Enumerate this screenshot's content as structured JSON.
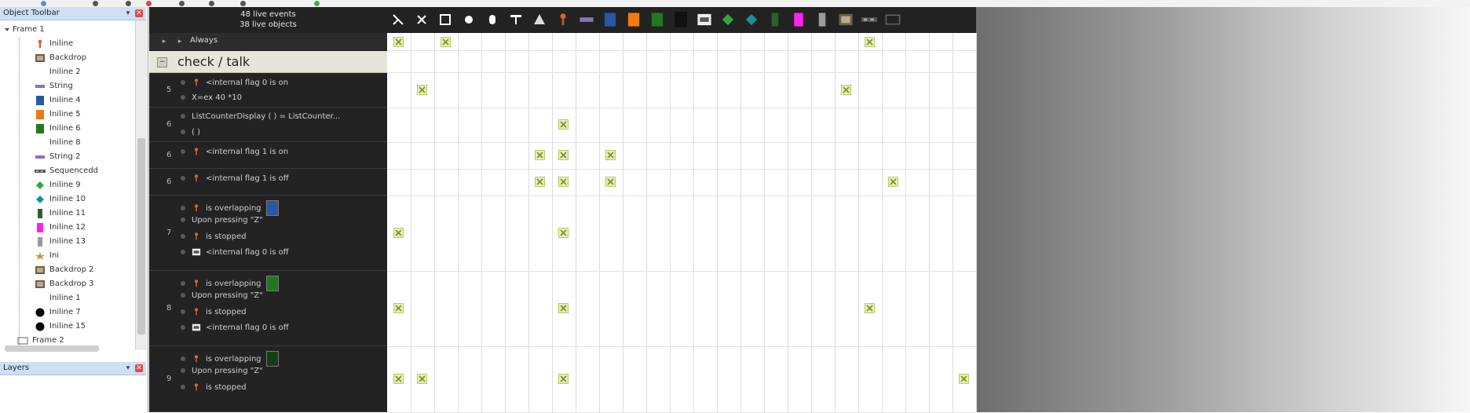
{
  "header": {
    "events_count": "48 live events",
    "objects_count": "38 live objects"
  },
  "left_panel": {
    "title": "Object Toolbar",
    "pin_glyph": "▾",
    "close_glyph": "✕",
    "tree_root": "Frame 1",
    "items": [
      {
        "label": "Iniline",
        "icon": "active-icon"
      },
      {
        "label": "Backdrop",
        "icon": "backdrop-icon"
      },
      {
        "label": "Iniline 2",
        "icon": "blank-icon"
      },
      {
        "label": "String",
        "icon": "string-icon"
      },
      {
        "label": "Iniline 4",
        "icon": "blue-square-icon"
      },
      {
        "label": "Iniline 5",
        "icon": "orange-square-icon"
      },
      {
        "label": "Iniline 6",
        "icon": "green-square-icon"
      },
      {
        "label": "Iniline 8",
        "icon": "blank-icon"
      },
      {
        "label": "String 2",
        "icon": "string-icon"
      },
      {
        "label": "Sequencedd",
        "icon": "sequence-icon"
      },
      {
        "label": "Iniline 9",
        "icon": "green-diamond-icon"
      },
      {
        "label": "Iniline 10",
        "icon": "teal-diamond-icon"
      },
      {
        "label": "Iniline 11",
        "icon": "dark-green-icon"
      },
      {
        "label": "Iniline 12",
        "icon": "magenta-icon"
      },
      {
        "label": "Iniline 13",
        "icon": "gray-bar-icon"
      },
      {
        "label": "Ini",
        "icon": "star-icon"
      },
      {
        "label": "Backdrop 2",
        "icon": "backdrop-icon"
      },
      {
        "label": "Backdrop 3",
        "icon": "backdrop-icon"
      },
      {
        "label": "Iniline 1",
        "icon": "blank-icon"
      },
      {
        "label": "Iniline 7",
        "icon": "black-circle-icon"
      },
      {
        "label": "Iniline 15",
        "icon": "black-circle-icon"
      },
      {
        "label": "Frame 2",
        "icon": "frame-icon"
      }
    ],
    "second_title": "Layers",
    "colors": {
      "blue": "#2a56a8",
      "orange": "#f07a12",
      "green": "#1f7a1f",
      "magenta": "#ff22ee"
    }
  },
  "toolbar": {
    "icons": [
      "system-icon",
      "special-icon",
      "storyboard-icon",
      "sound-icon",
      "mouse-icon",
      "timer-icon",
      "create-icon",
      "active-icon",
      "string-icon",
      "blue-square-icon",
      "orange-square-icon",
      "green-square-icon",
      "black-square-icon",
      "counter-icon",
      "green-diamond-icon",
      "teal-diamond-icon",
      "dark-green-icon",
      "magenta-icon",
      "gray-bar-icon",
      "backdrop-icon",
      "sequence-icon",
      "frame-icon"
    ]
  },
  "events": {
    "column_name": "Always",
    "section_title": "check / talk",
    "rows": [
      {
        "num": "5",
        "lines": [
          {
            "icon": "active-icon",
            "text": "<internal flag 0 is on"
          },
          {
            "icon": "",
            "text": "X=ex 40 *10"
          }
        ]
      },
      {
        "num": "6",
        "lines": [
          {
            "icon": "",
            "text": "ListCounterDisplay ( ) = ListCounter..."
          },
          {
            "icon": "",
            "text": "( )"
          }
        ]
      },
      {
        "num": "6",
        "lines": [
          {
            "icon": "active-icon",
            "text": "<internal flag 1 is on"
          }
        ]
      },
      {
        "num": "6",
        "lines": [
          {
            "icon": "active-icon",
            "text": "<internal flag 1 is off"
          }
        ]
      },
      {
        "num": "7",
        "lines": [
          {
            "icon": "active-icon",
            "text": "is overlapping",
            "square": "#2a56a8"
          },
          {
            "icon": "",
            "text": "Upon pressing \"Z\""
          },
          {
            "icon": "active-icon",
            "text": "is stopped"
          },
          {
            "icon": "counter-icon",
            "text": "<internal flag 0 is off"
          }
        ]
      },
      {
        "num": "8",
        "lines": [
          {
            "icon": "active-icon",
            "text": "is overlapping",
            "square": "#1f7a1f"
          },
          {
            "icon": "",
            "text": "Upon pressing \"Z\""
          },
          {
            "icon": "active-icon",
            "text": "is stopped"
          },
          {
            "icon": "counter-icon",
            "text": "<internal flag 0 is off"
          }
        ]
      },
      {
        "num": "9",
        "lines": [
          {
            "icon": "active-icon",
            "text": "is overlapping",
            "square": "#163d16"
          },
          {
            "icon": "",
            "text": "Upon pressing \"Z\""
          },
          {
            "icon": "active-icon",
            "text": "is stopped"
          }
        ]
      }
    ]
  }
}
